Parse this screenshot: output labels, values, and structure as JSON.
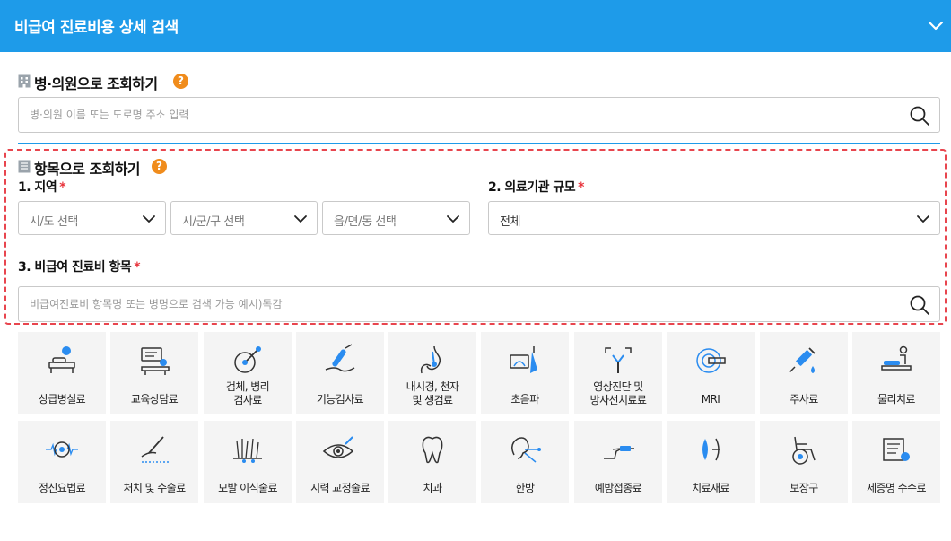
{
  "header": {
    "title": "비급여 진료비용 상세 검색"
  },
  "hospital_search": {
    "title": "병·의원으로 조회하기",
    "help": "?",
    "placeholder": "병·의원 이름 또는 도로명 주소 입력"
  },
  "item_search": {
    "title": "항목으로 조회하기",
    "help": "?",
    "region": {
      "label": "1. 지역",
      "required": "*",
      "sido": "시/도 선택",
      "sigungu": "시/군/구 선택",
      "eupmyeondong": "읍/면/동 선택"
    },
    "scale": {
      "label": "2. 의료기관 규모",
      "required": "*",
      "value": "전체"
    },
    "item": {
      "label": "3. 비급여 진료비 항목",
      "required": "*",
      "placeholder": "비급여진료비 항목명 또는 병명으로 검색 가능 예시)독감"
    }
  },
  "categories": [
    {
      "label": "상급병실료",
      "icon": "hospital-bed-icon"
    },
    {
      "label": "교육상담료",
      "icon": "counseling-icon"
    },
    {
      "label": "검체, 병리\n검사료",
      "icon": "specimen-test-icon"
    },
    {
      "label": "기능검사료",
      "icon": "function-test-icon"
    },
    {
      "label": "내시경, 천자\n및 생검료",
      "icon": "endoscope-icon"
    },
    {
      "label": "초음파",
      "icon": "ultrasound-icon"
    },
    {
      "label": "영상진단 및\n방사선치료료",
      "icon": "radiology-icon"
    },
    {
      "label": "MRI",
      "icon": "mri-icon"
    },
    {
      "label": "주사료",
      "icon": "syringe-icon"
    },
    {
      "label": "물리치료",
      "icon": "physical-therapy-icon"
    },
    {
      "label": "정신요법료",
      "icon": "psychotherapy-icon"
    },
    {
      "label": "처치 및 수술료",
      "icon": "surgery-icon"
    },
    {
      "label": "모발 이식술료",
      "icon": "hair-transplant-icon"
    },
    {
      "label": "시력 교정술료",
      "icon": "vision-correction-icon"
    },
    {
      "label": "치과",
      "icon": "tooth-icon"
    },
    {
      "label": "한방",
      "icon": "oriental-medicine-icon"
    },
    {
      "label": "예방접종료",
      "icon": "vaccination-icon"
    },
    {
      "label": "치료재료",
      "icon": "treatment-material-icon"
    },
    {
      "label": "보장구",
      "icon": "wheelchair-icon"
    },
    {
      "label": "제증명 수수료",
      "icon": "certificate-icon"
    }
  ],
  "colors": {
    "header": "#1e9be9",
    "accent": "#1e9be9",
    "help": "#f08c1c",
    "required": "#e8343c",
    "highlight": "#e8454e"
  }
}
